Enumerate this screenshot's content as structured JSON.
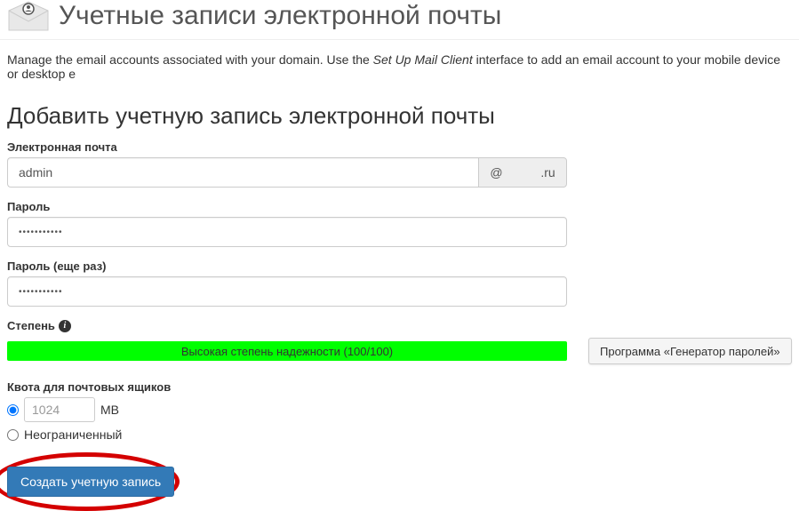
{
  "header": {
    "title": "Учетные записи электронной почты"
  },
  "description": {
    "part1": "Manage the email accounts associated with your domain. Use the ",
    "italic": "Set Up Mail Client",
    "part2": " interface to add an email account to your mobile device or desktop e"
  },
  "section": {
    "title": "Добавить учетную запись электронной почты"
  },
  "email": {
    "label": "Электронная почта",
    "value": "admin",
    "domain_prefix": "@",
    "domain_suffix": ".ru"
  },
  "password": {
    "label": "Пароль",
    "value": "•••••••••••"
  },
  "password_confirm": {
    "label": "Пароль (еще раз)",
    "value": "•••••••••••"
  },
  "strength": {
    "label": "Степень",
    "bar_text": "Высокая степень надежности (100/100)",
    "generator_button": "Программа «Генератор паролей»"
  },
  "quota": {
    "label": "Квота для почтовых ящиков",
    "value": "1024",
    "unit": "MB",
    "unlimited_label": "Неограниченный"
  },
  "submit": {
    "label": "Создать учетную запись"
  }
}
